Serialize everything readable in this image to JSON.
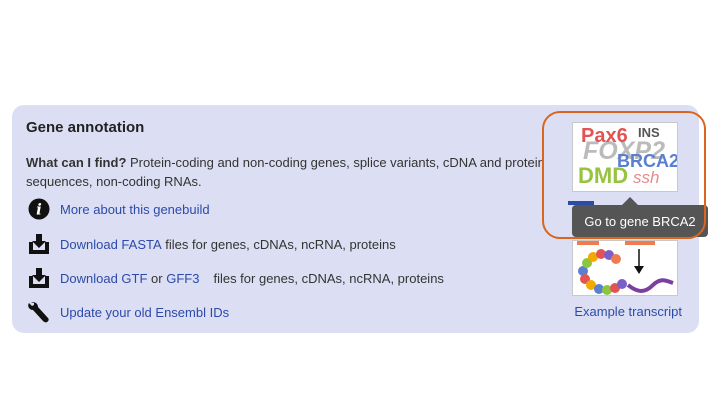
{
  "panel": {
    "title": "Gene annotation",
    "what_label": "What can I find?",
    "what_text": " Protein-coding and non-coding genes, splice variants, cDNA and protein sequences, non-coding RNAs."
  },
  "links": {
    "genebuild": "More about this genebuild",
    "download_fasta": "Download FASTA",
    "fasta_suffix": " files for genes, cDNAs, ncRNA, proteins",
    "download_gtf": "Download GTF",
    "or_text": " or ",
    "gff3": "GFF3",
    "gtf_suffix": " files for genes, cDNAs, ncRNA, proteins",
    "update_ids": "Update your old Ensembl IDs"
  },
  "gene_tile": {
    "words": [
      "Pax6",
      "INS",
      "FOXP2",
      "BRCA2",
      "DMD",
      "ssh"
    ]
  },
  "tooltip": "Go to gene BRCA2",
  "example_transcript": "Example transcript",
  "icons": {
    "info": "info-icon",
    "download": "download-icon",
    "wrench": "wrench-icon"
  },
  "colors": {
    "panel_bg": "#dcdff3",
    "link": "#2c4aa8",
    "highlight_border": "#d9661c",
    "tooltip_bg": "#555555"
  }
}
